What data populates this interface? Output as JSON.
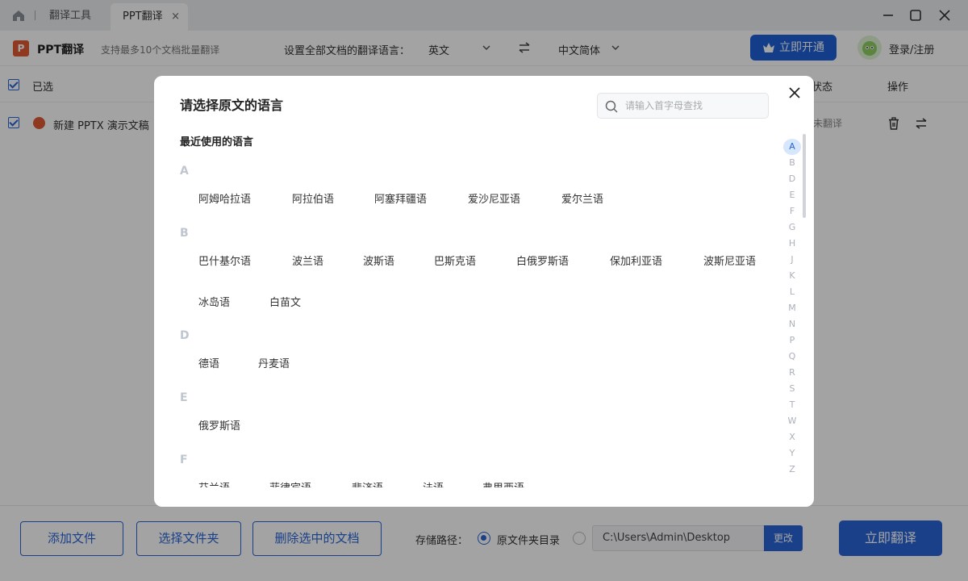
{
  "titlebar": {
    "tab_tools": "翻译工具",
    "tab_ppt": "PPT翻译",
    "tab_close": "×"
  },
  "toolbar": {
    "app_title": "PPT翻译",
    "logo_letter": "P",
    "subtitle": "支持最多10个文档批量翻译",
    "lang_label": "设置全部文档的翻译语言：",
    "source_lang": "英文",
    "target_lang": "中文简体",
    "vip_button": "立即开通",
    "login": "登录/注册"
  },
  "table": {
    "col_selected": "已选",
    "col_status": "状态",
    "col_ops": "操作",
    "rows": [
      {
        "name": "新建 PPTX 演示文稿",
        "status": "未翻译"
      }
    ]
  },
  "footer": {
    "add_file": "添加文件",
    "select_folder": "选择文件夹",
    "delete_selected": "删除选中的文档",
    "storage_label": "存储路径：",
    "radio_original": "原文件夹目录",
    "path_value": "C:\\Users\\Admin\\Desktop",
    "change": "更改",
    "translate_now": "立即翻译"
  },
  "modal": {
    "title": "请选择原文的语言",
    "search_placeholder": "请输入首字母查找",
    "recent_label": "最近使用的语言",
    "groups": [
      {
        "letter": "A",
        "languages": [
          "阿姆哈拉语",
          "阿拉伯语",
          "阿塞拜疆语",
          "爱沙尼亚语",
          "爱尔兰语"
        ]
      },
      {
        "letter": "B",
        "languages": [
          "巴什基尔语",
          "波兰语",
          "波斯语",
          "巴斯克语",
          "白俄罗斯语",
          "保加利亚语",
          "波斯尼亚语",
          "冰岛语",
          "白苗文"
        ]
      },
      {
        "letter": "D",
        "languages": [
          "德语",
          "丹麦语"
        ]
      },
      {
        "letter": "E",
        "languages": [
          "俄罗斯语"
        ]
      },
      {
        "letter": "F",
        "languages": [
          "芬兰语",
          "菲律宾语",
          "斐济语",
          "法语",
          "弗里西语"
        ]
      }
    ],
    "alphabet": [
      "A",
      "B",
      "D",
      "E",
      "F",
      "G",
      "H",
      "J",
      "K",
      "L",
      "M",
      "N",
      "P",
      "Q",
      "R",
      "S",
      "T",
      "W",
      "X",
      "Y",
      "Z"
    ],
    "active_letter": "A"
  },
  "colors": {
    "accent": "#2a64d6",
    "overlay": "#00000060",
    "letter_header": "#c0c6d0"
  },
  "icons": [
    "home-icon",
    "minimize-icon",
    "maximize-icon",
    "close-window-icon",
    "ppt-logo-icon",
    "chevron-down-icon",
    "swap-icon",
    "crown-icon",
    "avatar",
    "checkbox-icon",
    "trash-icon",
    "search-icon",
    "close-icon"
  ]
}
